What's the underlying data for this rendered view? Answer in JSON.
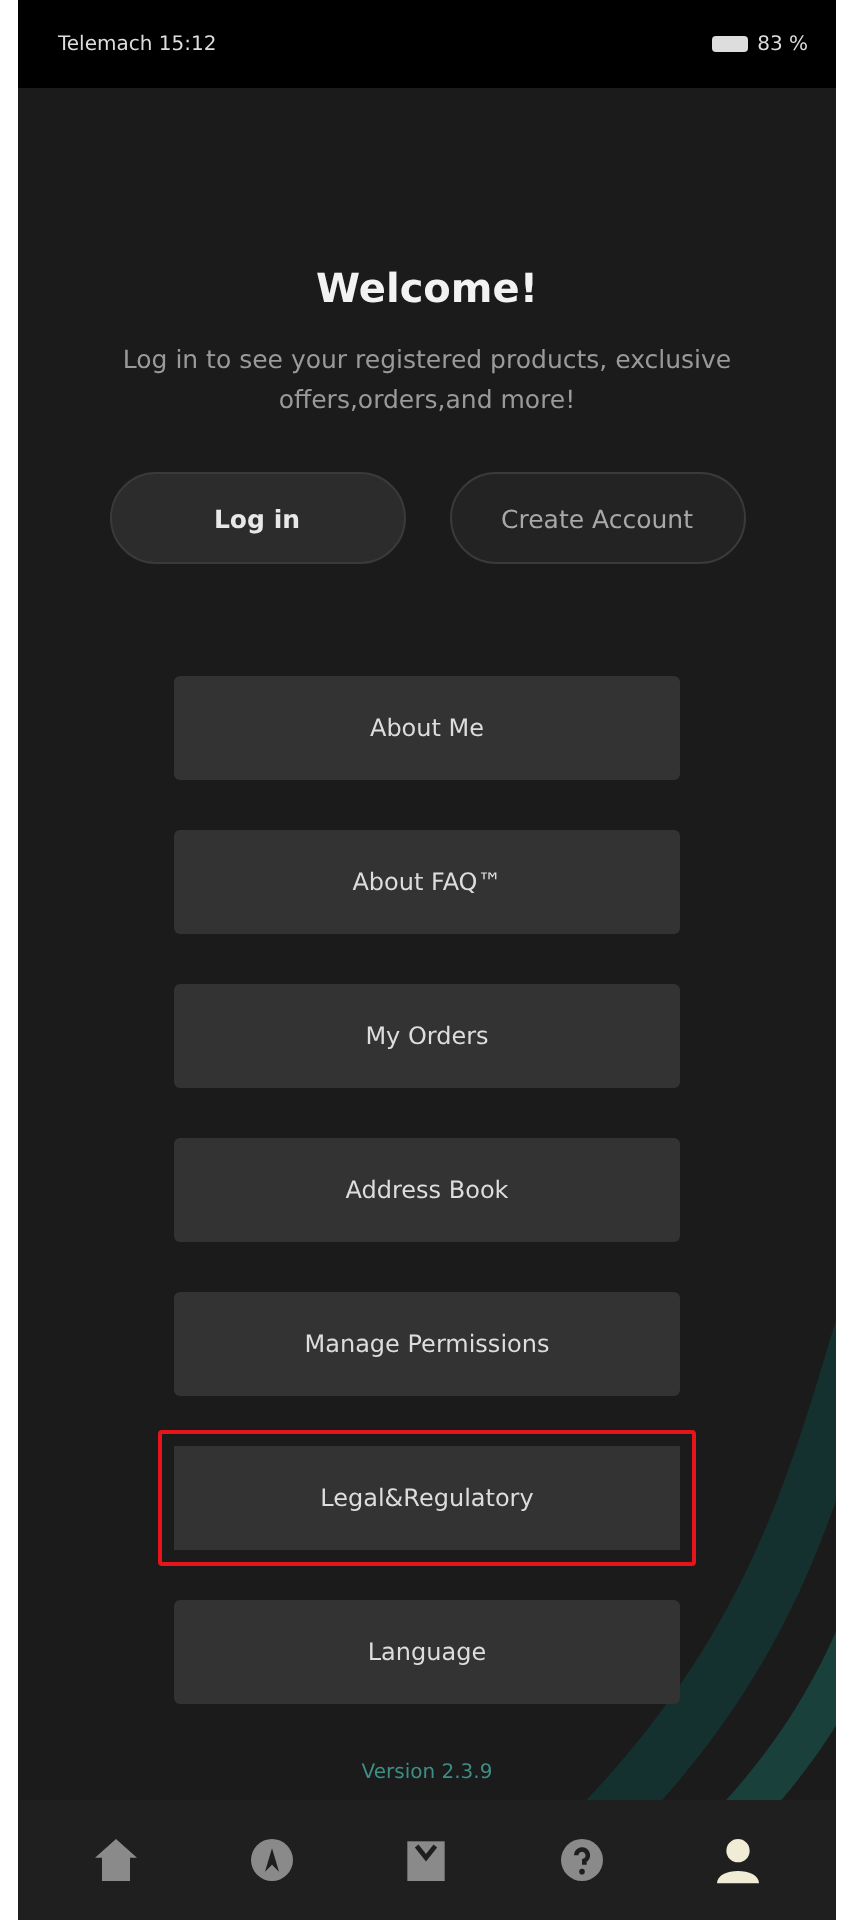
{
  "status_bar": {
    "carrier_time": "Telemach 15:12",
    "battery": "83 %"
  },
  "welcome": {
    "title": "Welcome!",
    "subtitle": "Log in to see your registered products, exclusive offers,orders,and more!"
  },
  "auth_buttons": [
    {
      "label": "Log in",
      "kind": "primary"
    },
    {
      "label": "Create Account",
      "kind": "secondary"
    }
  ],
  "menu": [
    {
      "label": "About Me",
      "highlighted": false
    },
    {
      "label": "About FAQ™",
      "highlighted": false
    },
    {
      "label": "My Orders",
      "highlighted": false
    },
    {
      "label": "Address Book",
      "highlighted": false
    },
    {
      "label": "Manage Permissions",
      "highlighted": false
    },
    {
      "label": "Legal&Regulatory",
      "highlighted": true
    },
    {
      "label": "Language",
      "highlighted": false
    }
  ],
  "version": "Version 2.3.9",
  "bottom_nav": [
    {
      "kind": "home",
      "selected": false
    },
    {
      "kind": "explore",
      "selected": false
    },
    {
      "kind": "shop",
      "selected": false
    },
    {
      "kind": "help",
      "selected": false
    },
    {
      "kind": "account",
      "selected": true
    }
  ]
}
